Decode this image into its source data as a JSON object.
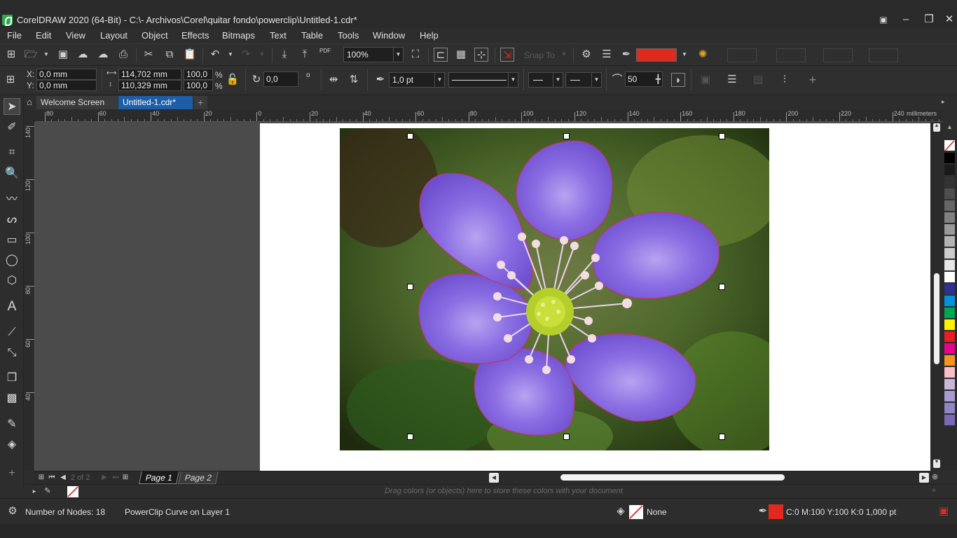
{
  "window": {
    "title": "CorelDRAW 2020 (64-Bit) - C:\\- Archivos\\Corel\\quitar fondo\\powerclip\\Untitled-1.cdr*",
    "minimize": "–",
    "maximize": "❐",
    "close": "✕"
  },
  "menu": [
    {
      "label": "File"
    },
    {
      "label": "Edit"
    },
    {
      "label": "View"
    },
    {
      "label": "Layout"
    },
    {
      "label": "Object"
    },
    {
      "label": "Effects"
    },
    {
      "label": "Bitmaps"
    },
    {
      "label": "Text"
    },
    {
      "label": "Table"
    },
    {
      "label": "Tools"
    },
    {
      "label": "Window"
    },
    {
      "label": "Help"
    }
  ],
  "toolbar": {
    "zoom": "100%",
    "snap_to": "Snap To",
    "fill_color": "#e0291f",
    "pdf_label": "PDF"
  },
  "property_bar": {
    "x_label": "X:",
    "x_value": "0,0 mm",
    "y_label": "Y:",
    "y_value": "0,0 mm",
    "width_value": "114,702 mm",
    "height_value": "110,329 mm",
    "scale_x": "100,0",
    "scale_y": "100,0",
    "percent": "%",
    "rotation": "0,0",
    "degree": "o",
    "outline_width": "1,0 pt",
    "smoothing": "50",
    "plus": "+"
  },
  "tabs": {
    "welcome": "Welcome Screen",
    "document": "Untitled-1.cdr*",
    "add": "+"
  },
  "ruler": {
    "unit": "millimeters",
    "h_ticks": [
      "80",
      "60",
      "40",
      "20",
      "0",
      "20",
      "40",
      "60",
      "80",
      "100",
      "120",
      "140",
      "160",
      "180",
      "200",
      "220",
      "240"
    ],
    "v_ticks": [
      "140",
      "120",
      "100",
      "80",
      "60",
      "40"
    ]
  },
  "page_nav": {
    "counter": "2 of 2",
    "page1": "Page 1",
    "page2": "Page 2"
  },
  "doc_palette": {
    "hint": "Drag colors (or objects) here to store these colors with your document"
  },
  "status": {
    "nodes": "Number of Nodes: 18",
    "object": "PowerClip Curve on Layer 1",
    "fill": "None",
    "outline": "C:0 M:100 Y:100 K:0  1,000 pt",
    "outline_color": "#e0291f"
  },
  "palette_colors": [
    "#000000",
    "#1a1a1a",
    "#333333",
    "#4d4d4d",
    "#666666",
    "#808080",
    "#999999",
    "#b3b3b3",
    "#cccccc",
    "#e6e6e6",
    "#ffffff",
    "#2e3192",
    "#0093dd",
    "#00a651",
    "#fff200",
    "#ed1c24",
    "#ec008c",
    "#f7941d",
    "#f9bfc7",
    "#c7b8d9",
    "#a99bd1",
    "#8e85c4",
    "#7b68b5"
  ]
}
